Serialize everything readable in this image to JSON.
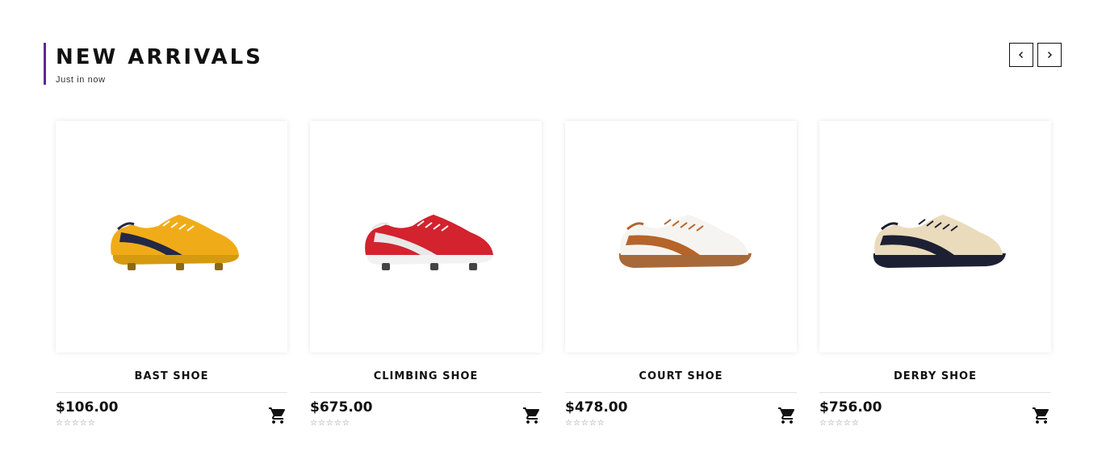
{
  "section": {
    "title": "NEW ARRIVALS",
    "subtitle": "Just in now",
    "accent_color": "#5b2a91",
    "prev_icon": "chevron-left-icon",
    "next_icon": "chevron-right-icon"
  },
  "products": [
    {
      "name": "BAST SHOE",
      "price": "$106.00",
      "rating": "☆☆☆☆☆",
      "image": "yellow-football-boot",
      "colors": {
        "upper": "#f0ac18",
        "stripe": "#232845",
        "sole": "#d69a10",
        "studs": "#8a6a12"
      }
    },
    {
      "name": "CLIMBING SHOE",
      "price": "$675.00",
      "rating": "☆☆☆☆☆",
      "image": "red-football-boot",
      "colors": {
        "upper": "#d2232f",
        "stripe": "#e8e8e8",
        "sole": "#f2f2f2",
        "studs": "#444444"
      }
    },
    {
      "name": "COURT SHOE",
      "price": "$478.00",
      "rating": "☆☆☆☆☆",
      "image": "white-brown-sneaker",
      "colors": {
        "upper": "#f6f4f0",
        "stripe": "#b5642a",
        "sole": "#a8693a",
        "studs": "#a8693a"
      }
    },
    {
      "name": "DERBY SHOE",
      "price": "$756.00",
      "rating": "☆☆☆☆☆",
      "image": "beige-navy-sneaker",
      "colors": {
        "upper": "#eadbbc",
        "stripe": "#1d1f33",
        "sole": "#1d1f33",
        "studs": "#1d1f33"
      }
    }
  ],
  "icons": {
    "cart": "shopping-cart-icon"
  }
}
